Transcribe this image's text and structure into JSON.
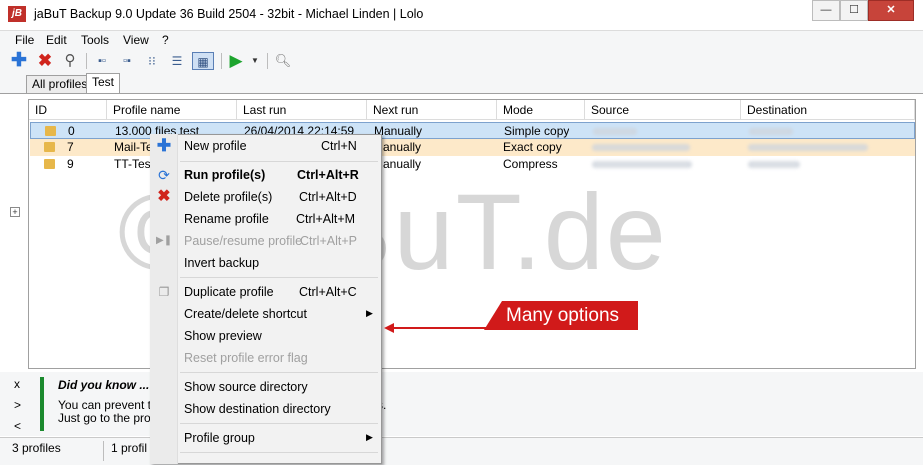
{
  "window": {
    "app_icon": "jB",
    "title": "jaBuT Backup 9.0 Update 36 Build 2504 - 32bit - Michael Linden   |   Lolo",
    "minimize": "—",
    "maximize": "☐",
    "close": "✕"
  },
  "menu": [
    "File",
    "Edit",
    "Tools",
    "View",
    "?"
  ],
  "toolbar": {
    "icons": [
      "add-icon",
      "delete-icon",
      "search-icon",
      "view-icon",
      "view-icon",
      "view-icon",
      "view-icon",
      "grid-view-icon",
      "run-icon",
      "dropdown-icon",
      "preview-icon"
    ]
  },
  "tabs": [
    "All profiles",
    "Test"
  ],
  "table": {
    "columns": [
      "ID",
      "Profile name",
      "Last run",
      "Next run",
      "Mode",
      "Source",
      "Destination"
    ],
    "rows": [
      {
        "id": "0",
        "name": "13.000 files test",
        "last_run": "26/04/2014 22:14:59",
        "next_run": "Manually",
        "mode": "Simple copy"
      },
      {
        "id": "7",
        "name": "Mail-Test",
        "last_run": "",
        "next_run": "Manually",
        "mode": "Exact copy"
      },
      {
        "id": "9",
        "name": "TT-Test",
        "last_run": "",
        "next_run": "Manually",
        "mode": "Compress"
      }
    ]
  },
  "did_you_know": {
    "title": "Did you know ...",
    "line1": "You can prevent th",
    "line1_end": "s.",
    "line2": "Just go to the profi",
    "nav": [
      "x",
      ">",
      "<"
    ]
  },
  "status": {
    "profiles": "3 profiles",
    "selected": "1 profil"
  },
  "watermark": "© jaBuT.de",
  "context_menu": {
    "items": [
      {
        "label": "New profile",
        "shortcut": "Ctrl+N"
      },
      {
        "label": "Run profile(s)",
        "shortcut": "Ctrl+Alt+R"
      },
      {
        "label": "Delete profile(s)",
        "shortcut": "Ctrl+Alt+D"
      },
      {
        "label": "Rename profile",
        "shortcut": "Ctrl+Alt+M"
      },
      {
        "label": "Pause/resume profile",
        "shortcut": "Ctrl+Alt+P"
      },
      {
        "label": "Invert backup",
        "shortcut": ""
      },
      {
        "label": "Duplicate profile",
        "shortcut": "Ctrl+Alt+C"
      },
      {
        "label": "Create/delete shortcut",
        "shortcut": ""
      },
      {
        "label": "Show preview",
        "shortcut": ""
      },
      {
        "label": "Reset profile error flag",
        "shortcut": ""
      },
      {
        "label": "Show source directory",
        "shortcut": ""
      },
      {
        "label": "Show destination directory",
        "shortcut": ""
      },
      {
        "label": "Profile group",
        "shortcut": ""
      }
    ]
  },
  "callout": "Many options",
  "colors": {
    "accent": "#d11a1a",
    "selected_row": "#cde3f7",
    "highlight_row": "#fde9c9",
    "did_you_know_bar": "#1b8a2e"
  }
}
